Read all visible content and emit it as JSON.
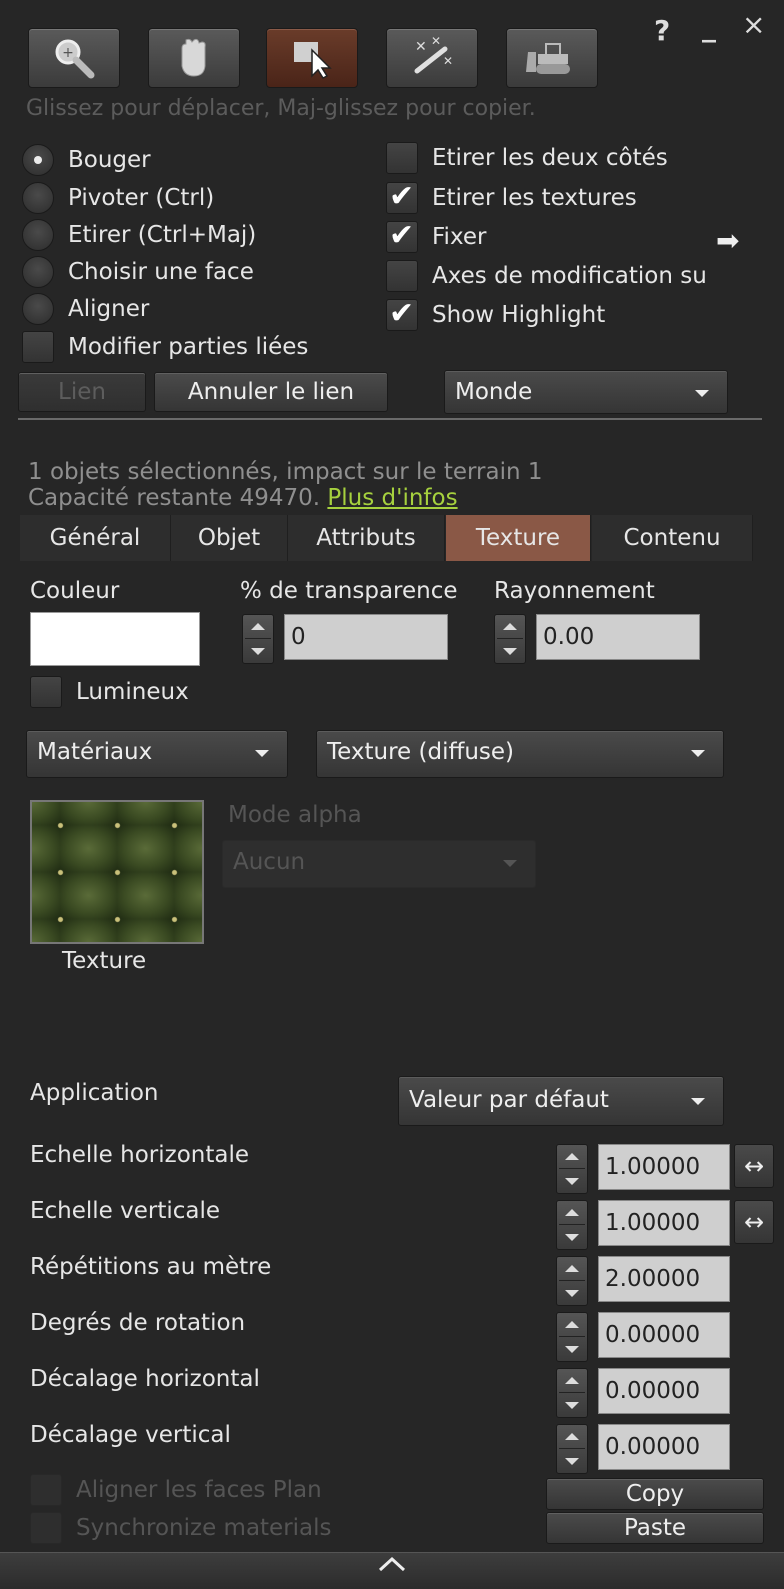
{
  "window": {
    "help": "?",
    "minimize": "_",
    "close": "×"
  },
  "toolbar": {
    "tools": [
      {
        "icon": "zoom-icon",
        "active": false
      },
      {
        "icon": "grab-hand-icon",
        "active": false
      },
      {
        "icon": "edit-pointer-icon",
        "active": true
      },
      {
        "icon": "create-wand-icon",
        "active": false
      },
      {
        "icon": "land-bulldozer-icon",
        "active": false
      }
    ],
    "hint": "Glissez pour déplacer, Maj-glissez pour copier."
  },
  "modes": [
    {
      "label": "Bouger",
      "selected": true
    },
    {
      "label": "Pivoter (Ctrl)",
      "selected": false
    },
    {
      "label": "Etirer (Ctrl+Maj)",
      "selected": false
    },
    {
      "label": "Choisir une face",
      "selected": false
    },
    {
      "label": "Aligner",
      "selected": false
    }
  ],
  "modify_linked": {
    "label": "Modifier parties liées",
    "checked": false
  },
  "options": [
    {
      "label": "Etirer les deux côtés",
      "checked": false
    },
    {
      "label": "Etirer les textures",
      "checked": true
    },
    {
      "label": "Fixer",
      "checked": true
    },
    {
      "label": "Axes de modification su",
      "checked": false
    },
    {
      "label": "Show Highlight",
      "checked": true
    }
  ],
  "link_buttons": {
    "link": "Lien",
    "unlink": "Annuler le lien"
  },
  "ruler_dropdown": "Monde",
  "selection_info": {
    "line1": "1 objets sélectionnés, impact sur le terrain 1",
    "line2_prefix": "Capacité restante 49470.",
    "more_link": "Plus d'infos"
  },
  "tabs": [
    "Général",
    "Objet",
    "Attributs",
    "Texture",
    "Contenu"
  ],
  "active_tab": "Texture",
  "texture_panel": {
    "color_label": "Couleur",
    "transparency_label": "% de transparence",
    "transparency_value": "0",
    "glow_label": "Rayonnement",
    "glow_value": "0.00",
    "fullbright_label": "Lumineux",
    "materials_dropdown": "Matériaux",
    "texture_type_dropdown": "Texture (diffuse)",
    "alpha_mode_label": "Mode alpha",
    "alpha_mode_value": "Aucun",
    "texture_caption": "Texture",
    "mapping_label": "Application",
    "mapping_value": "Valeur par défaut",
    "rows": [
      {
        "label": "Echelle horizontale",
        "value": "1.00000"
      },
      {
        "label": "Echelle verticale",
        "value": "1.00000"
      },
      {
        "label": "Répétitions au mètre",
        "value": "2.00000"
      },
      {
        "label": "Degrés de rotation",
        "value": "0.00000"
      },
      {
        "label": "Décalage horizontal",
        "value": "0.00000"
      },
      {
        "label": "Décalage vertical",
        "value": "0.00000"
      }
    ],
    "align_planar": "Aligner les faces Plan",
    "sync_materials": "Synchronize materials",
    "copy": "Copy",
    "paste": "Paste"
  }
}
